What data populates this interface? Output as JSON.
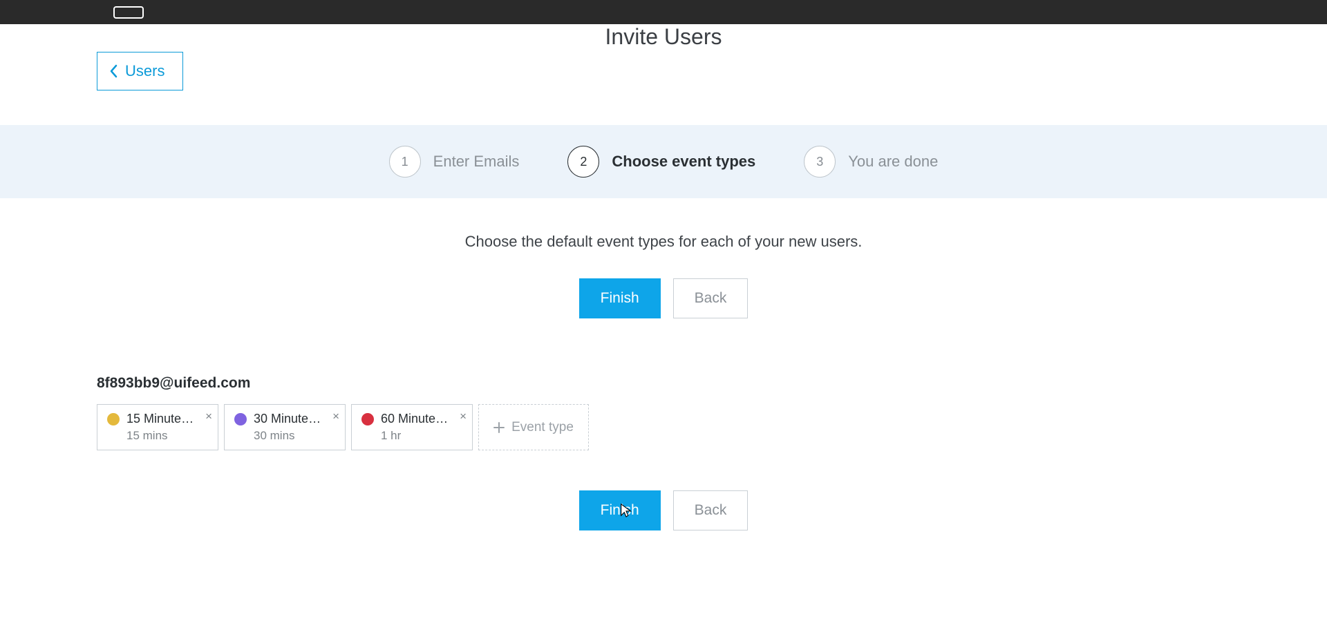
{
  "header": {
    "back_label": "Users",
    "page_title": "Invite Users"
  },
  "stepper": {
    "steps": [
      {
        "number": "1",
        "label": "Enter Emails",
        "active": false
      },
      {
        "number": "2",
        "label": "Choose event types",
        "active": true
      },
      {
        "number": "3",
        "label": "You are done",
        "active": false
      }
    ]
  },
  "main": {
    "instruction": "Choose the default event types for each of your new users.",
    "finish_label": "Finish",
    "back_label": "Back"
  },
  "user": {
    "email": "8f893bb9@uifeed.com",
    "events": [
      {
        "name": "15 Minute M...",
        "duration": "15 mins",
        "color": "#e4b93c"
      },
      {
        "name": "30 Minute ...",
        "duration": "30 mins",
        "color": "#7f63e0"
      },
      {
        "name": "60 Minute ...",
        "duration": "1 hr",
        "color": "#d8303f"
      }
    ],
    "add_event_label": "Event type"
  }
}
